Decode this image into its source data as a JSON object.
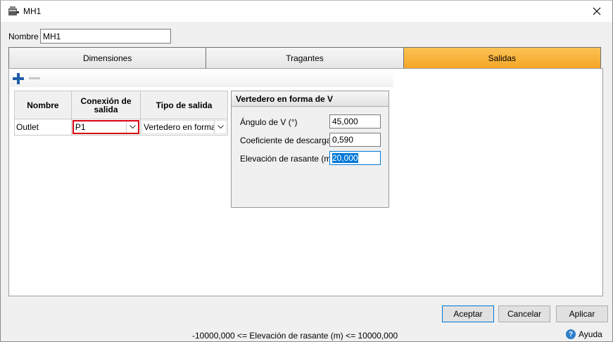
{
  "window": {
    "title": "MH1"
  },
  "name_field": {
    "label": "Nombre",
    "value": "MH1"
  },
  "tabs": [
    {
      "label": "Dimensiones",
      "active": false
    },
    {
      "label": "Tragantes",
      "active": false
    },
    {
      "label": "Salidas",
      "active": true
    }
  ],
  "outlets": {
    "headers": {
      "name": "Nombre",
      "connection": "Conexión de salida",
      "type": "Tipo de salida"
    },
    "rows": [
      {
        "name": "Outlet",
        "connection": "P1",
        "type": "Vertedero en forma d"
      }
    ]
  },
  "weir": {
    "title": "Vertedero en forma de V",
    "fields": [
      {
        "label": "Ángulo de V (°)",
        "value": "45,000"
      },
      {
        "label": "Coeficiente de descarga",
        "value": "0,590"
      },
      {
        "label": "Elevación de rasante (m)",
        "value": "20,000"
      }
    ]
  },
  "buttons": {
    "accept": "Aceptar",
    "cancel": "Cancelar",
    "apply": "Aplicar"
  },
  "status": "-10000,000 <= Elevación de rasante (m) <= 10000,000",
  "help": "Ayuda",
  "colors": {
    "active_tab": "#f5a628",
    "focus_border": "#d7000f",
    "selection": "#0078d7"
  }
}
